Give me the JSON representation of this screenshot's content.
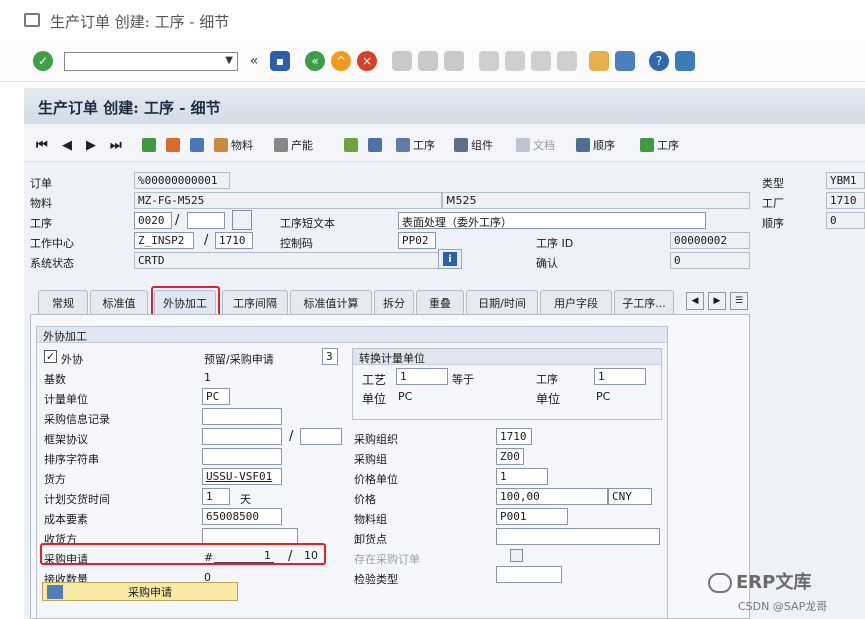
{
  "window": {
    "title": "生产订单 创建: 工序 - 细节"
  },
  "systoolbar": {
    "command_value": ""
  },
  "panel": {
    "title": "生产订单 创建: 工序 - 细节"
  },
  "apptoolbar": {
    "material": "物料",
    "capacity": "产能",
    "operation": "工序",
    "component": "组件",
    "document": "文档",
    "sequence": "顺序",
    "operation2": "工序"
  },
  "header": {
    "order_label": "订单",
    "order_value": "%00000000001",
    "material_label": "物料",
    "material_value": "MZ-FG-M525",
    "material_desc": "M525",
    "operation_label": "工序",
    "operation_value": "0020",
    "operation_sub": "",
    "op_short_text_label": "工序短文本",
    "op_short_text_value": "表面处理（委外工序）",
    "workcenter_label": "工作中心",
    "workcenter_value": "Z_INSP2",
    "plant_value": "1710",
    "control_key_label": "控制码",
    "control_key_value": "PP02",
    "op_id_label": "工序 ID",
    "op_id_value": "00000002",
    "status_label": "系统状态",
    "status_value": "CRTD",
    "confirm_label": "确认",
    "confirm_value": "0",
    "type_label": "类型",
    "type_value": "YBM1",
    "plant_label": "工厂",
    "plant_value2": "1710",
    "seq_label": "顺序",
    "seq_value": "0"
  },
  "tabs": [
    "常规",
    "标准值",
    "外协加工",
    "工序间隔",
    "标准值计算",
    "拆分",
    "重叠",
    "日期/时间",
    "用户字段",
    "子工序..."
  ],
  "subcontract": {
    "group_title": "外协加工",
    "subcontract_label": "外协",
    "subcontract_checked": "✓",
    "reserve_label": "预留/采购申请",
    "reserve_value": "3",
    "base_label": "基数",
    "base_value": "1",
    "uom_label": "计量单位",
    "uom_value": "PC",
    "info_record_label": "采购信息记录",
    "framework_label": "框架协议",
    "sort_label": "排序字符串",
    "vendor_label": "货方",
    "vendor_value": "USSU-VSF01",
    "delivery_label": "计划交货时间",
    "delivery_value": "1",
    "delivery_unit": "天",
    "cost_element_label": "成本要素",
    "cost_element_value": "65008500",
    "recipient_label": "收货方",
    "pr_label": "采购申请",
    "pr_hash": "#",
    "pr_item": "1",
    "pr_total": "10",
    "recv_qty_label": "接收数量",
    "recv_qty_value": "0",
    "pr_button": "采购申请",
    "purch_org_label": "采购组织",
    "purch_org_value": "1710",
    "purch_group_label": "采购组",
    "purch_group_value": "Z00",
    "price_unit_label": "价格单位",
    "price_unit_value": "1",
    "price_label": "价格",
    "price_value": "100,00",
    "currency_value": "CNY",
    "mat_group_label": "物料组",
    "mat_group_value": "P001",
    "unload_label": "卸货点",
    "in_po_label": "存在采购订单",
    "inspection_label": "检验类型"
  },
  "conversion": {
    "title": "转换计量单位",
    "process_label": "工艺",
    "process_value": "1",
    "equals": "等于",
    "operation_label": "工序",
    "operation_value": "1",
    "unit_label": "单位",
    "unit_value": "PC",
    "unit_label2": "单位",
    "unit_value2": "PC"
  },
  "watermark": {
    "brand": "ERP文库",
    "credit": "CSDN @SAP龙哥"
  }
}
